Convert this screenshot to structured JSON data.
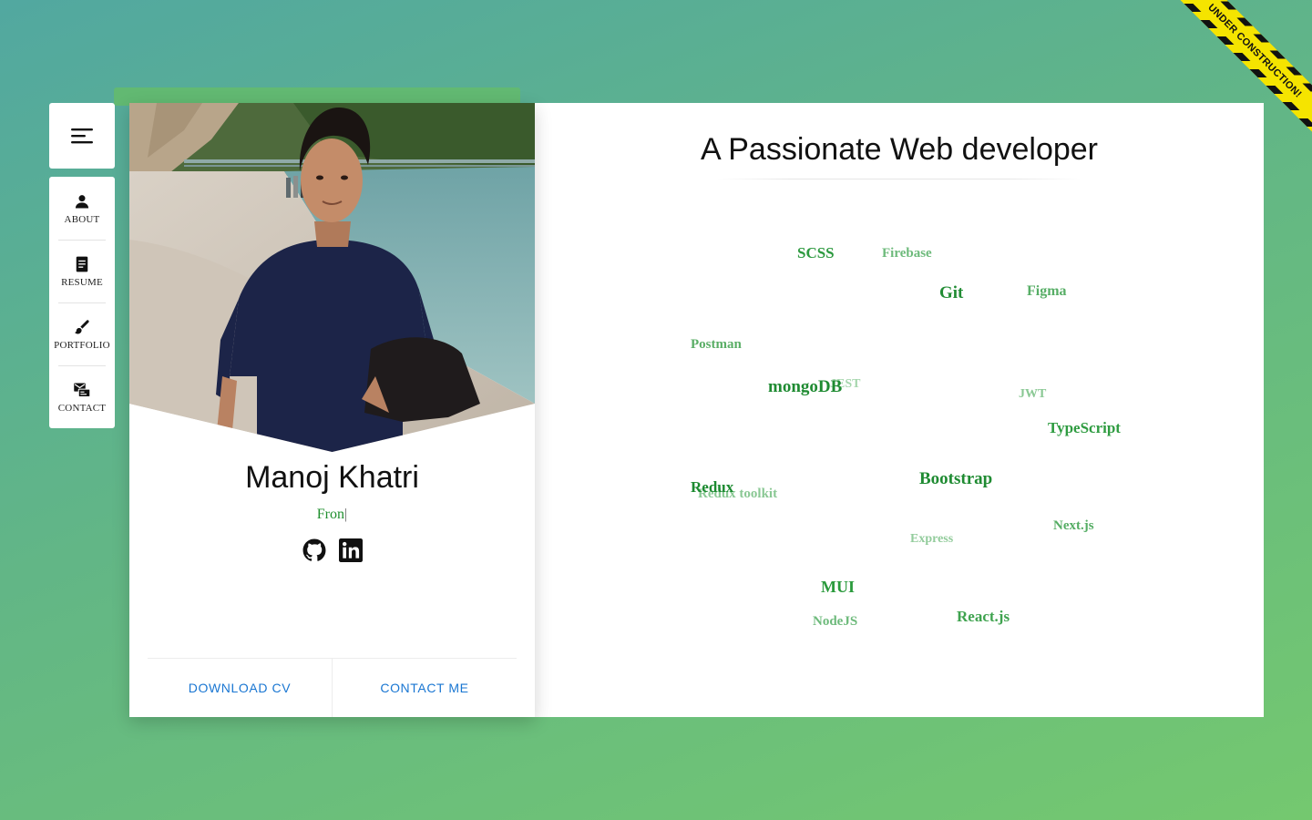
{
  "ribbon": {
    "text": "UNDER CONSTRUCTION!"
  },
  "sidebar": {
    "toggle_icon": "menu-icon",
    "items": [
      {
        "label": "ABOUT",
        "icon": "person-icon"
      },
      {
        "label": "RESUME",
        "icon": "document-icon"
      },
      {
        "label": "PORTFOLIO",
        "icon": "brush-icon"
      },
      {
        "label": "CONTACT",
        "icon": "contact-mail-icon"
      }
    ]
  },
  "profile": {
    "name": "Manoj Khatri",
    "role_typed": "Fron",
    "cursor": "|",
    "socials": [
      {
        "name": "github",
        "icon": "github-icon"
      },
      {
        "name": "linkedin",
        "icon": "linkedin-icon"
      }
    ],
    "actions": {
      "download_cv": "DOWNLOAD CV",
      "contact_me": "CONTACT ME"
    }
  },
  "main": {
    "headline": "A Passionate Web developer",
    "skills": [
      {
        "label": "SCSS",
        "color": "#2e9a40"
      },
      {
        "label": "Firebase",
        "color": "#6dba7b"
      },
      {
        "label": "Git",
        "color": "#218c34"
      },
      {
        "label": "Figma",
        "color": "#57ae66"
      },
      {
        "label": "Postman",
        "color": "#5aae66"
      },
      {
        "label": "mongoDB",
        "color": "#1f8b32"
      },
      {
        "label": "JEST",
        "color": "#a6d6ad"
      },
      {
        "label": "JWT",
        "color": "#8ac894"
      },
      {
        "label": "TypeScript",
        "color": "#2f9c41"
      },
      {
        "label": "Redux",
        "color": "#1c8a30"
      },
      {
        "label": "Redux toolkit",
        "color": "#8ac894"
      },
      {
        "label": "Bootstrap",
        "color": "#1f8b32"
      },
      {
        "label": "Next.js",
        "color": "#55ad64"
      },
      {
        "label": "Express",
        "color": "#93cc9c"
      },
      {
        "label": "MUI",
        "color": "#2a9a3c"
      },
      {
        "label": "NodeJS",
        "color": "#6dba7b"
      },
      {
        "label": "React.js",
        "color": "#3fa34f"
      }
    ]
  },
  "colors": {
    "accent_link": "#1976d2",
    "role_text": "#1f8f2e"
  }
}
